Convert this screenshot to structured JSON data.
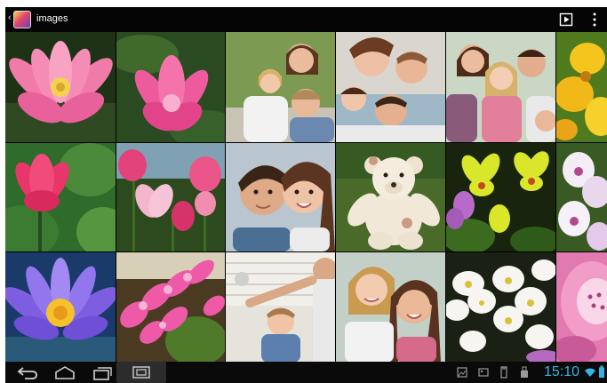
{
  "action_bar": {
    "title": "images",
    "back_icon": "back-caret-icon",
    "app_icon": "gallery-app-icon",
    "slideshow_icon": "slideshow-icon",
    "overflow_icon": "overflow-menu-icon"
  },
  "photos": [
    {
      "subject": "pink-lotus"
    },
    {
      "subject": "pink-lotus"
    },
    {
      "subject": "family-portrait"
    },
    {
      "subject": "family-portrait"
    },
    {
      "subject": "family-portrait"
    },
    {
      "subject": "yellow-flower"
    },
    {
      "subject": "pink-flower"
    },
    {
      "subject": "pink-tulips"
    },
    {
      "subject": "couple-portrait"
    },
    {
      "subject": "teddy-bear"
    },
    {
      "subject": "yellow-orchids"
    },
    {
      "subject": "white-orchids"
    },
    {
      "subject": "purple-lotus"
    },
    {
      "subject": "pink-blossoms"
    },
    {
      "subject": "father-son"
    },
    {
      "subject": "mother-daughter"
    },
    {
      "subject": "white-flowers"
    },
    {
      "subject": "pink-flower-closeup"
    }
  ],
  "nav_bar": {
    "back_icon": "back-icon",
    "home_icon": "home-icon",
    "recents_icon": "recent-apps-icon",
    "screenshot_icon": "screenshot-icon"
  },
  "status_bar": {
    "time": "15:10",
    "icons": [
      "gallery-notification-icon",
      "image-notification-icon",
      "sd-card-icon",
      "usb-icon",
      "wifi-icon",
      "battery-icon"
    ],
    "accent_color": "#33b5e5"
  }
}
